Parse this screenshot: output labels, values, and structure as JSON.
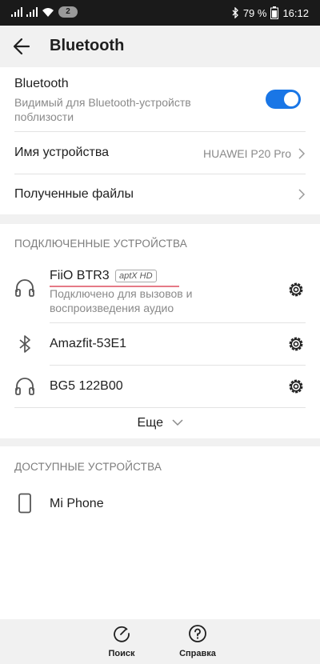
{
  "status_bar": {
    "notification_count": "2",
    "battery": "79 %",
    "time": "16:12"
  },
  "header": {
    "title": "Bluetooth"
  },
  "bluetooth_card": {
    "bt_title": "Bluetooth",
    "bt_subtitle_line1": "Видимый для Bluetooth-устройств",
    "bt_subtitle_line2": "поблизости",
    "toggle_on": true,
    "device_name_label": "Имя устройства",
    "device_name_value": "HUAWEI P20 Pro",
    "received_files_label": "Полученные файлы"
  },
  "connected": {
    "header": "ПОДКЛЮЧЕННЫЕ УСТРОЙСТВА",
    "devices": [
      {
        "name": "FiiO BTR3",
        "codec": "aptX HD",
        "status_line1": "Подключено для вызовов и",
        "status_line2": "воспроизведения аудио",
        "icon": "headset-icon"
      },
      {
        "name": "Amazfit-53E1",
        "icon": "bluetooth-icon"
      },
      {
        "name": "BG5 122B00",
        "icon": "headset-icon"
      }
    ],
    "more_label": "Еще"
  },
  "available": {
    "header": "ДОСТУПНЫЕ УСТРОЙСТВА",
    "devices": [
      {
        "name": "Mi Phone",
        "icon": "phone-icon"
      }
    ]
  },
  "bottom_bar": {
    "search_label": "Поиск",
    "help_label": "Справка"
  },
  "colors": {
    "accent": "#1976e6",
    "underline": "#e57a86"
  }
}
